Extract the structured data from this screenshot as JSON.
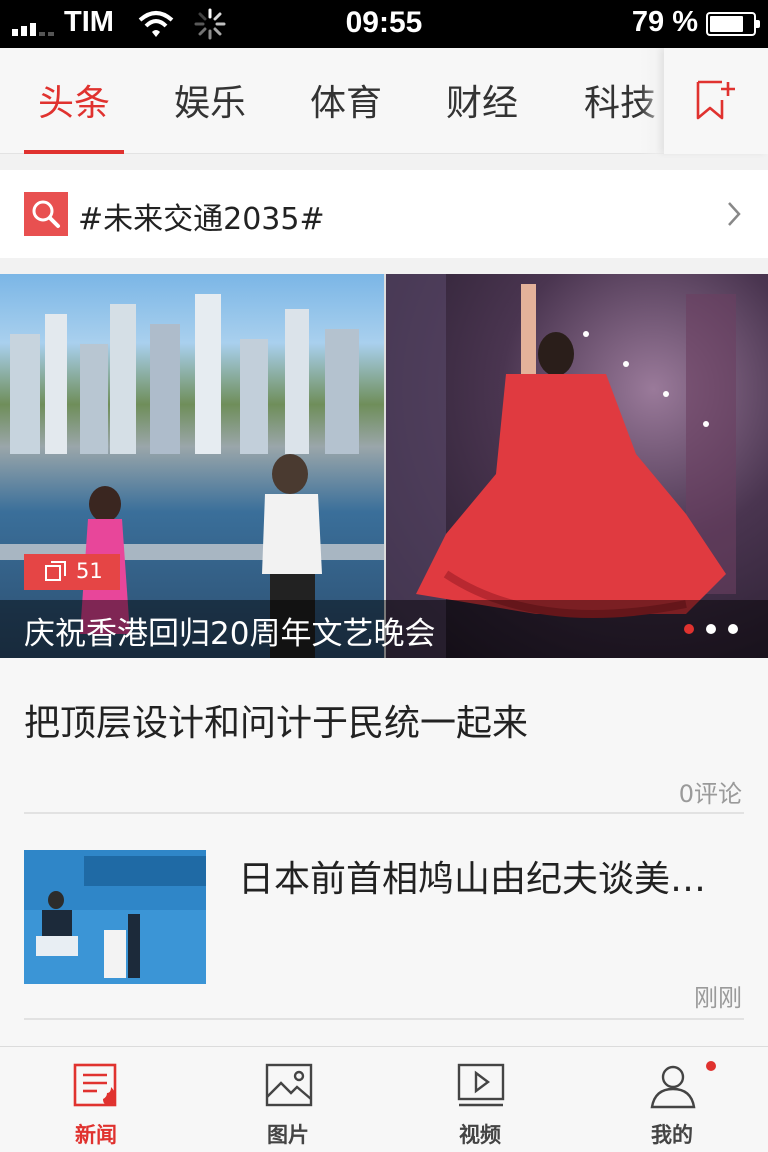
{
  "status_bar": {
    "carrier": "TIM",
    "time": "09:55",
    "battery_text": "79 %",
    "battery_level": 0.79
  },
  "tabs": [
    {
      "label": "头条",
      "active": true
    },
    {
      "label": "娱乐",
      "active": false
    },
    {
      "label": "体育",
      "active": false
    },
    {
      "label": "财经",
      "active": false
    },
    {
      "label": "科技",
      "active": false
    }
  ],
  "topic": {
    "text": "#未来交通2035#"
  },
  "carousel": {
    "caption": "庆祝香港回归20周年文艺晚会",
    "photo_count": "51",
    "dots": 3,
    "active_dot": 0
  },
  "articles": [
    {
      "title": "把顶层设计和问计于民统一起来",
      "meta": "0评论"
    },
    {
      "title": "日本前首相鸠山由纪夫谈美…",
      "meta": "刚刚"
    }
  ],
  "bottom_nav": [
    {
      "label": "新闻",
      "icon": "news-icon",
      "active": true
    },
    {
      "label": "图片",
      "icon": "picture-icon",
      "active": false
    },
    {
      "label": "视频",
      "icon": "video-icon",
      "active": false
    },
    {
      "label": "我的",
      "icon": "profile-icon",
      "active": false
    }
  ],
  "colors": {
    "accent": "#e0322f"
  }
}
